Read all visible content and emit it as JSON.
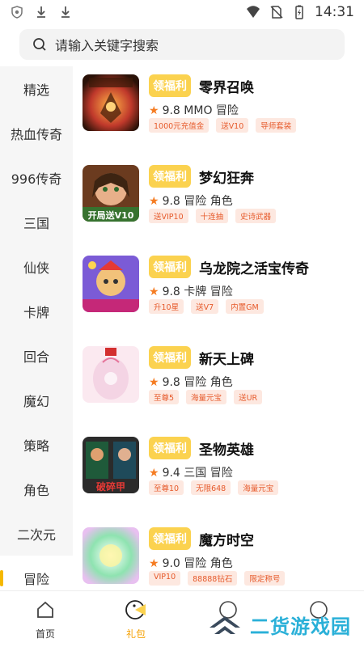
{
  "status_bar": {
    "time": "14:31"
  },
  "search": {
    "placeholder": "请输入关键字搜索"
  },
  "sidebar": {
    "items": [
      {
        "label": "精选"
      },
      {
        "label": "热血传奇"
      },
      {
        "label": "996传奇"
      },
      {
        "label": "三国"
      },
      {
        "label": "仙侠"
      },
      {
        "label": "卡牌"
      },
      {
        "label": "回合"
      },
      {
        "label": "魔幻"
      },
      {
        "label": "策略"
      },
      {
        "label": "角色"
      },
      {
        "label": "二次元"
      },
      {
        "label": "冒险"
      }
    ],
    "active_index": 11
  },
  "games": [
    {
      "welfare_label": "领福利",
      "name": "零界召唤",
      "rating": "9.8",
      "genres": "MMO 冒险",
      "tags": [
        "1000元充值金",
        "送V10",
        "导师套装"
      ]
    },
    {
      "welfare_label": "领福利",
      "name": "梦幻狂奔",
      "rating": "9.8",
      "genres": "冒险 角色",
      "tags": [
        "送VIP10",
        "十连抽",
        "史诗武器"
      ]
    },
    {
      "welfare_label": "领福利",
      "name": "乌龙院之活宝传奇",
      "rating": "9.8",
      "genres": "卡牌 冒险",
      "tags": [
        "升10星",
        "送V7",
        "内置GM"
      ]
    },
    {
      "welfare_label": "领福利",
      "name": "新天上碑",
      "rating": "9.8",
      "genres": "冒险 角色",
      "tags": [
        "至尊5",
        "海量元宝",
        "送UR"
      ]
    },
    {
      "welfare_label": "领福利",
      "name": "圣物英雄",
      "rating": "9.4",
      "genres": "三国 冒险",
      "tags": [
        "至尊10",
        "无限648",
        "海量元宝"
      ]
    },
    {
      "welfare_label": "领福利",
      "name": "魔方时空",
      "rating": "9.0",
      "genres": "冒险 角色",
      "tags": [
        "VIP10",
        "88888钻石",
        "限定称号"
      ]
    }
  ],
  "thumb_texts": {
    "game2": "开局送V10",
    "game5": "破碎甲"
  },
  "bottom_nav": {
    "home_label": "首页",
    "gift_label": "礼包"
  },
  "watermark": {
    "text": "二货游戏园"
  },
  "colors": {
    "accent": "#fbd24f",
    "active_text": "#f5a000",
    "tag_text": "#e65a2b",
    "tag_bg": "#fde8e0",
    "star": "#f57c22"
  }
}
